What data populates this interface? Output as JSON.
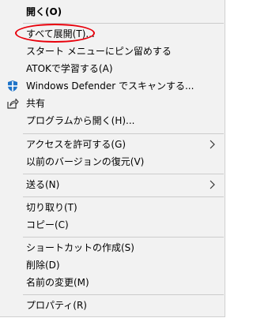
{
  "menu": {
    "items": [
      {
        "label": "開く(O)"
      },
      {
        "label": "すべて展開(T)..."
      },
      {
        "label": "スタート メニューにピン留めする"
      },
      {
        "label": "ATOKで学習する(A)"
      },
      {
        "label": "Windows Defender でスキャンする..."
      },
      {
        "label": "共有"
      },
      {
        "label": "プログラムから開く(H)..."
      },
      {
        "label": "アクセスを許可する(G)"
      },
      {
        "label": "以前のバージョンの復元(V)"
      },
      {
        "label": "送る(N)"
      },
      {
        "label": "切り取り(T)"
      },
      {
        "label": "コピー(C)"
      },
      {
        "label": "ショートカットの作成(S)"
      },
      {
        "label": "削除(D)"
      },
      {
        "label": "名前の変更(M)"
      },
      {
        "label": "プロパティ(R)"
      }
    ]
  },
  "icons": {
    "defender": "windows-defender-shield-icon",
    "share": "share-icon",
    "submenu": "chevron-right-icon"
  },
  "colors": {
    "menu_bg": "#f2f2f2",
    "separator": "#cccccc",
    "highlight_ring": "#e8000b",
    "defender_blue": "#1e73c8"
  }
}
